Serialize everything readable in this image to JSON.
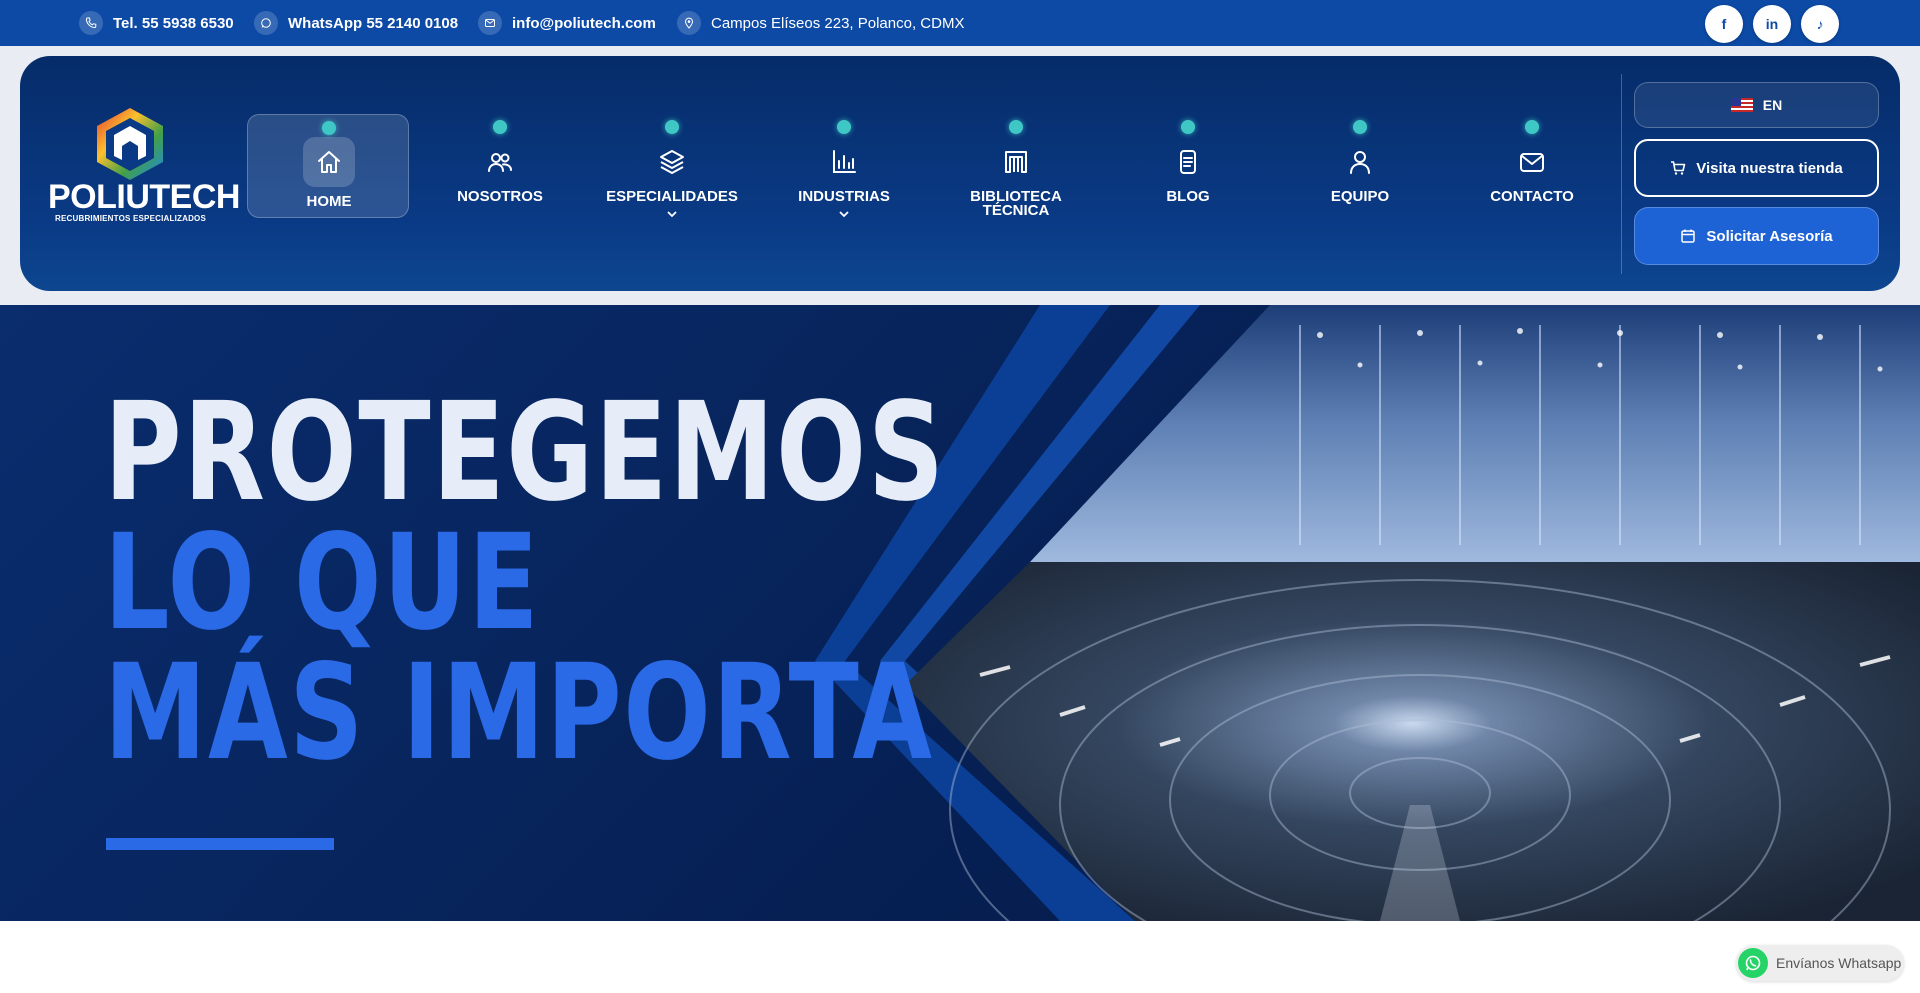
{
  "topbar": {
    "phone": "Tel. 55 5938 6530",
    "whatsapp": "WhatsApp 55 2140 0108",
    "email": "info@poliutech.com",
    "address": "Campos Elíseos 223, Polanco, CDMX",
    "social": [
      {
        "icon": "facebook-icon",
        "label": "f"
      },
      {
        "icon": "linkedin-icon",
        "label": "in"
      },
      {
        "icon": "tiktok-icon",
        "label": "♪"
      }
    ]
  },
  "brand": {
    "name": "POLIUTECH",
    "tagline": "RECUBRIMIENTOS ESPECIALIZADOS"
  },
  "nav": {
    "items": [
      {
        "label": "HOME",
        "icon": "home-icon",
        "active": true
      },
      {
        "label": "NOSOTROS",
        "icon": "users-icon"
      },
      {
        "label": "ESPECIALIDADES",
        "icon": "layers-icon",
        "dropdown": true
      },
      {
        "label": "INDUSTRIAS",
        "icon": "bar-chart-icon",
        "dropdown": true
      },
      {
        "label": "BIBLIOTECA TÉCNICA",
        "line1": "BIBLIOTECA",
        "line2": "TÉCNICA",
        "icon": "library-icon"
      },
      {
        "label": "BLOG",
        "icon": "document-icon"
      },
      {
        "label": "EQUIPO",
        "icon": "user-icon"
      },
      {
        "label": "CONTACTO",
        "icon": "mail-icon"
      }
    ]
  },
  "actions": {
    "language": "EN",
    "store": "Visita nuestra tienda",
    "advice": "Solicitar Asesoría"
  },
  "hero": {
    "line1": "PROTEGEMOS",
    "line2": "LO QUE",
    "line3": "MÁS IMPORTA"
  },
  "whatsapp_widget": {
    "label": "Envíanos Whatsapp"
  },
  "colors": {
    "topbar": "#0c4aa6",
    "header": "#062c69",
    "accent": "#2a6ae6",
    "dot": "#3ec7c4"
  }
}
